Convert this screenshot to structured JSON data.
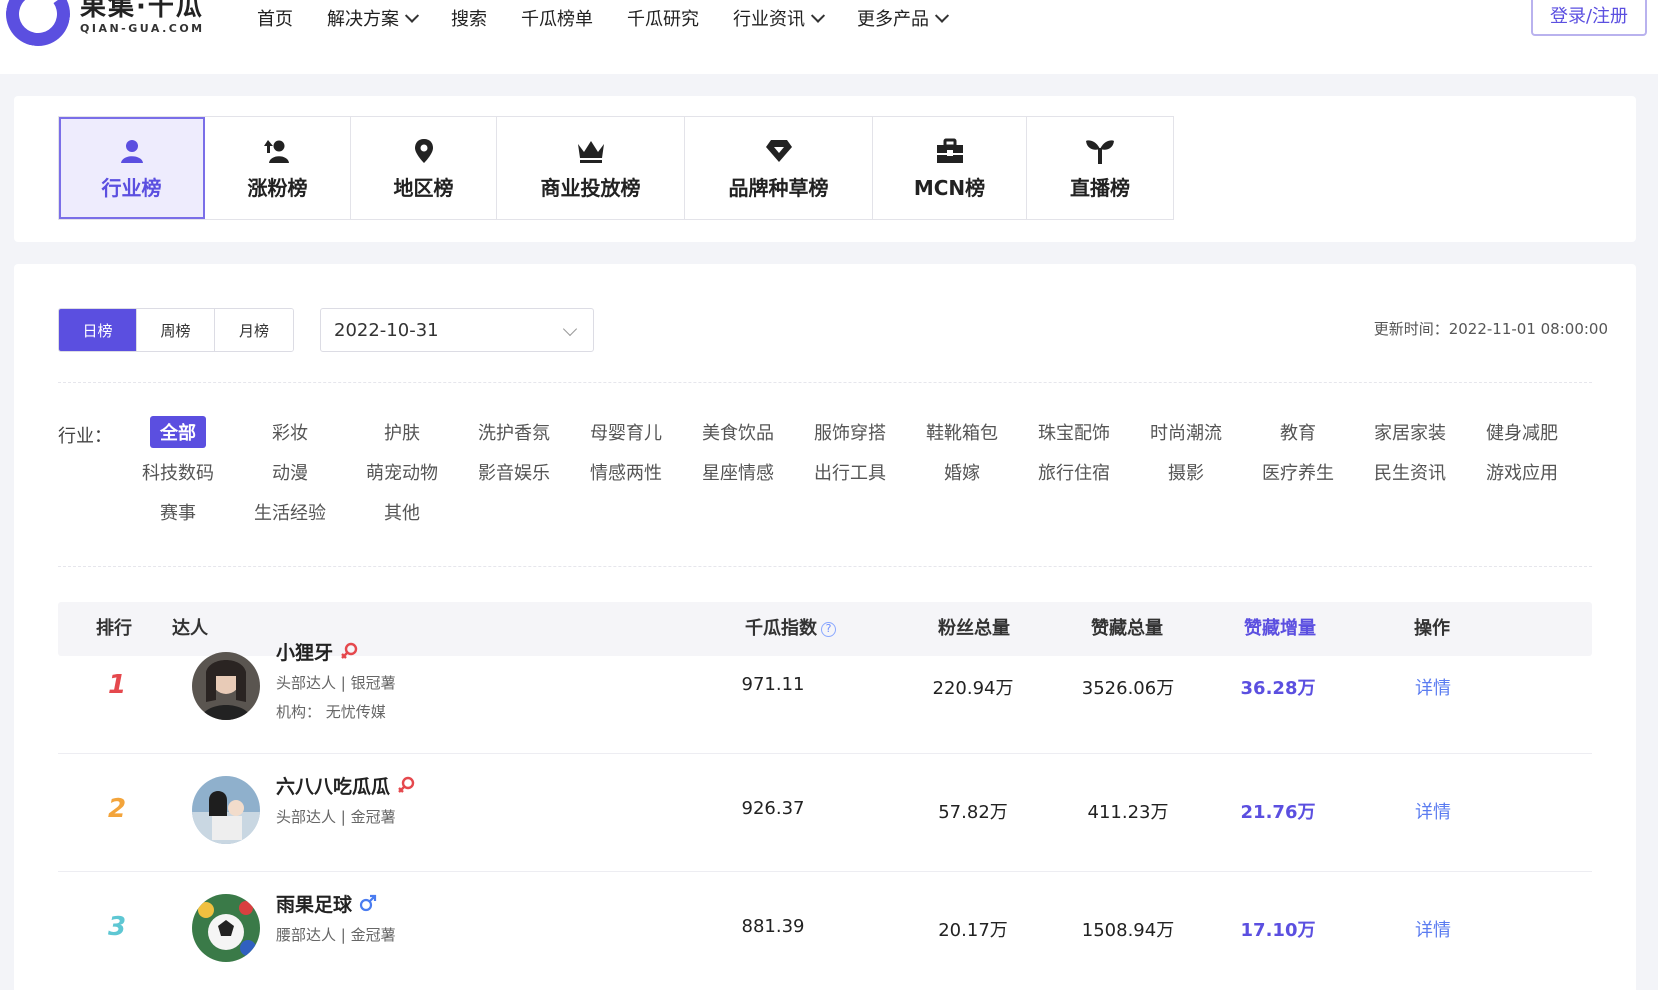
{
  "header": {
    "logo_cn": "果集·千瓜",
    "logo_en": "QIAN-GUA.COM",
    "nav": [
      {
        "label": "首页",
        "dropdown": false
      },
      {
        "label": "解决方案",
        "dropdown": true
      },
      {
        "label": "搜索",
        "dropdown": false
      },
      {
        "label": "千瓜榜单",
        "dropdown": false
      },
      {
        "label": "千瓜研究",
        "dropdown": false
      },
      {
        "label": "行业资讯",
        "dropdown": true
      },
      {
        "label": "更多产品",
        "dropdown": true
      }
    ],
    "login_label": "登录/注册"
  },
  "rank_tabs": [
    {
      "label": "行业榜",
      "icon": "person-icon",
      "active": true
    },
    {
      "label": "涨粉榜",
      "icon": "person-up-icon",
      "active": false
    },
    {
      "label": "地区榜",
      "icon": "location-pin-icon",
      "active": false
    },
    {
      "label": "商业投放榜",
      "icon": "crown-icon",
      "active": false
    },
    {
      "label": "品牌种草榜",
      "icon": "diamond-icon",
      "active": false
    },
    {
      "label": "MCN榜",
      "icon": "briefcase-icon",
      "active": false
    },
    {
      "label": "直播榜",
      "icon": "sprout-icon",
      "active": false
    }
  ],
  "filters": {
    "periods": [
      "日榜",
      "周榜",
      "月榜"
    ],
    "active_period": "日榜",
    "date_value": "2022-10-31",
    "update_time": "更新时间：2022-11-01 08:00:00",
    "industry_label": "行业：",
    "industries": [
      "全部",
      "彩妆",
      "护肤",
      "洗护香氛",
      "母婴育儿",
      "美食饮品",
      "服饰穿搭",
      "鞋靴箱包",
      "珠宝配饰",
      "时尚潮流",
      "教育",
      "家居家装",
      "健身减肥",
      "科技数码",
      "动漫",
      "萌宠动物",
      "影音娱乐",
      "情感两性",
      "星座情感",
      "出行工具",
      "婚嫁",
      "旅行住宿",
      "摄影",
      "医疗养生",
      "民生资讯",
      "游戏应用",
      "赛事",
      "生活经验",
      "其他"
    ],
    "active_industry": "全部"
  },
  "table": {
    "headers": {
      "rank": "排行",
      "kol": "达人",
      "index": "千瓜指数",
      "help": "?",
      "fans": "粉丝总量",
      "likes": "赞藏总量",
      "likes_growth": "赞藏增量",
      "action": "操作"
    },
    "rows": [
      {
        "rank": "1",
        "rank_color": "#e5484d",
        "name": "小狸牙",
        "gender": "female",
        "meta1": "头部达人 | 银冠薯",
        "meta2": "机构： 无忧传媒",
        "index": "971.11",
        "fans": "220.94万",
        "likes": "3526.06万",
        "growth": "36.28万",
        "action": "详情"
      },
      {
        "rank": "2",
        "rank_color": "#f3a43b",
        "name": "六八八吃瓜瓜",
        "gender": "female",
        "meta1": "头部达人 | 金冠薯",
        "meta2": "",
        "index": "926.37",
        "fans": "57.82万",
        "likes": "411.23万",
        "growth": "21.76万",
        "action": "详情"
      },
      {
        "rank": "3",
        "rank_color": "#5ec7d3",
        "name": "雨果足球",
        "gender": "male",
        "meta1": "腰部达人 | 金冠薯",
        "meta2": "",
        "index": "881.39",
        "fans": "20.17万",
        "likes": "1508.94万",
        "growth": "17.10万",
        "action": "详情"
      }
    ]
  },
  "colors": {
    "brand": "#5b4fe0",
    "female": "#e5484d",
    "male": "#4a7cf0"
  }
}
